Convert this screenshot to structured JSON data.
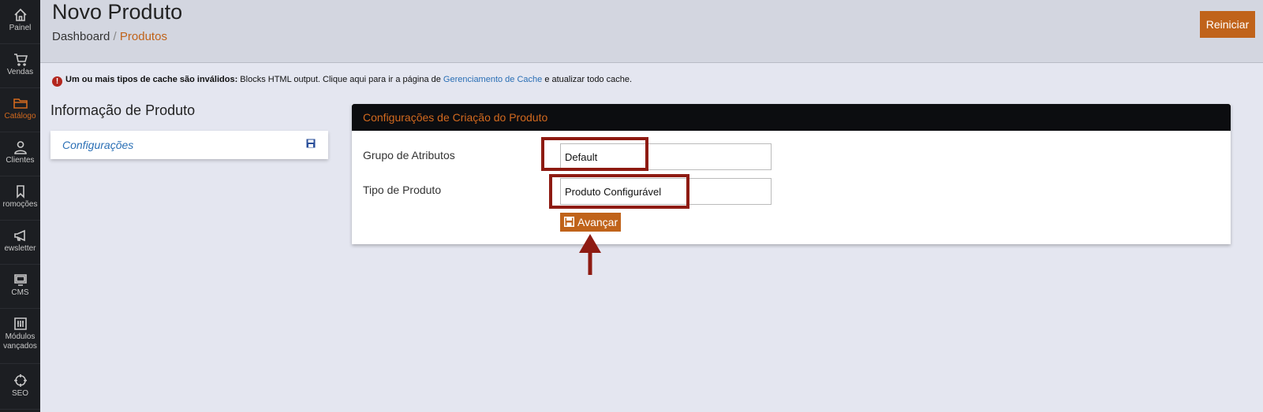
{
  "sidebar": {
    "items": [
      {
        "label": "Painel",
        "icon": "home-icon"
      },
      {
        "label": "Vendas",
        "icon": "cart-icon"
      },
      {
        "label": "Catálogo",
        "icon": "folder-icon",
        "active": true
      },
      {
        "label": "Clientes",
        "icon": "user-icon"
      },
      {
        "label": "romoções",
        "icon": "tag-icon"
      },
      {
        "label": "ewsletter",
        "icon": "megaphone-icon"
      },
      {
        "label": "CMS",
        "icon": "monitor-icon"
      },
      {
        "label": "Módulos",
        "label2": "vançados",
        "icon": "sliders-icon"
      },
      {
        "label": "SEO",
        "icon": "crosshair-icon"
      }
    ]
  },
  "header": {
    "title": "Novo Produto",
    "breadcrumb_root": "Dashboard",
    "breadcrumb_sep": " / ",
    "breadcrumb_current": "Produtos",
    "reset_label": "Reiniciar"
  },
  "alert": {
    "bold": "Um ou mais tipos de cache são inválidos:",
    "text1": " Blocks HTML output. Clique aqui para ir a página de ",
    "link": "Gerenciamento de Cache",
    "text2": " e atualizar todo cache."
  },
  "info": {
    "title": "Informação de Produto",
    "link": "Configurações"
  },
  "panel": {
    "title": "Configurações de Criação do Produto",
    "attr_group_label": "Grupo de Atributos",
    "attr_group_value": "Default",
    "product_type_label": "Tipo de Produto",
    "product_type_value": "Produto Configurável",
    "advance_label": "Avançar"
  },
  "colors": {
    "accent": "#c0631a",
    "highlight": "#8e1b12",
    "sidebar_bg": "#1c1e22",
    "link": "#2a6fb5"
  }
}
